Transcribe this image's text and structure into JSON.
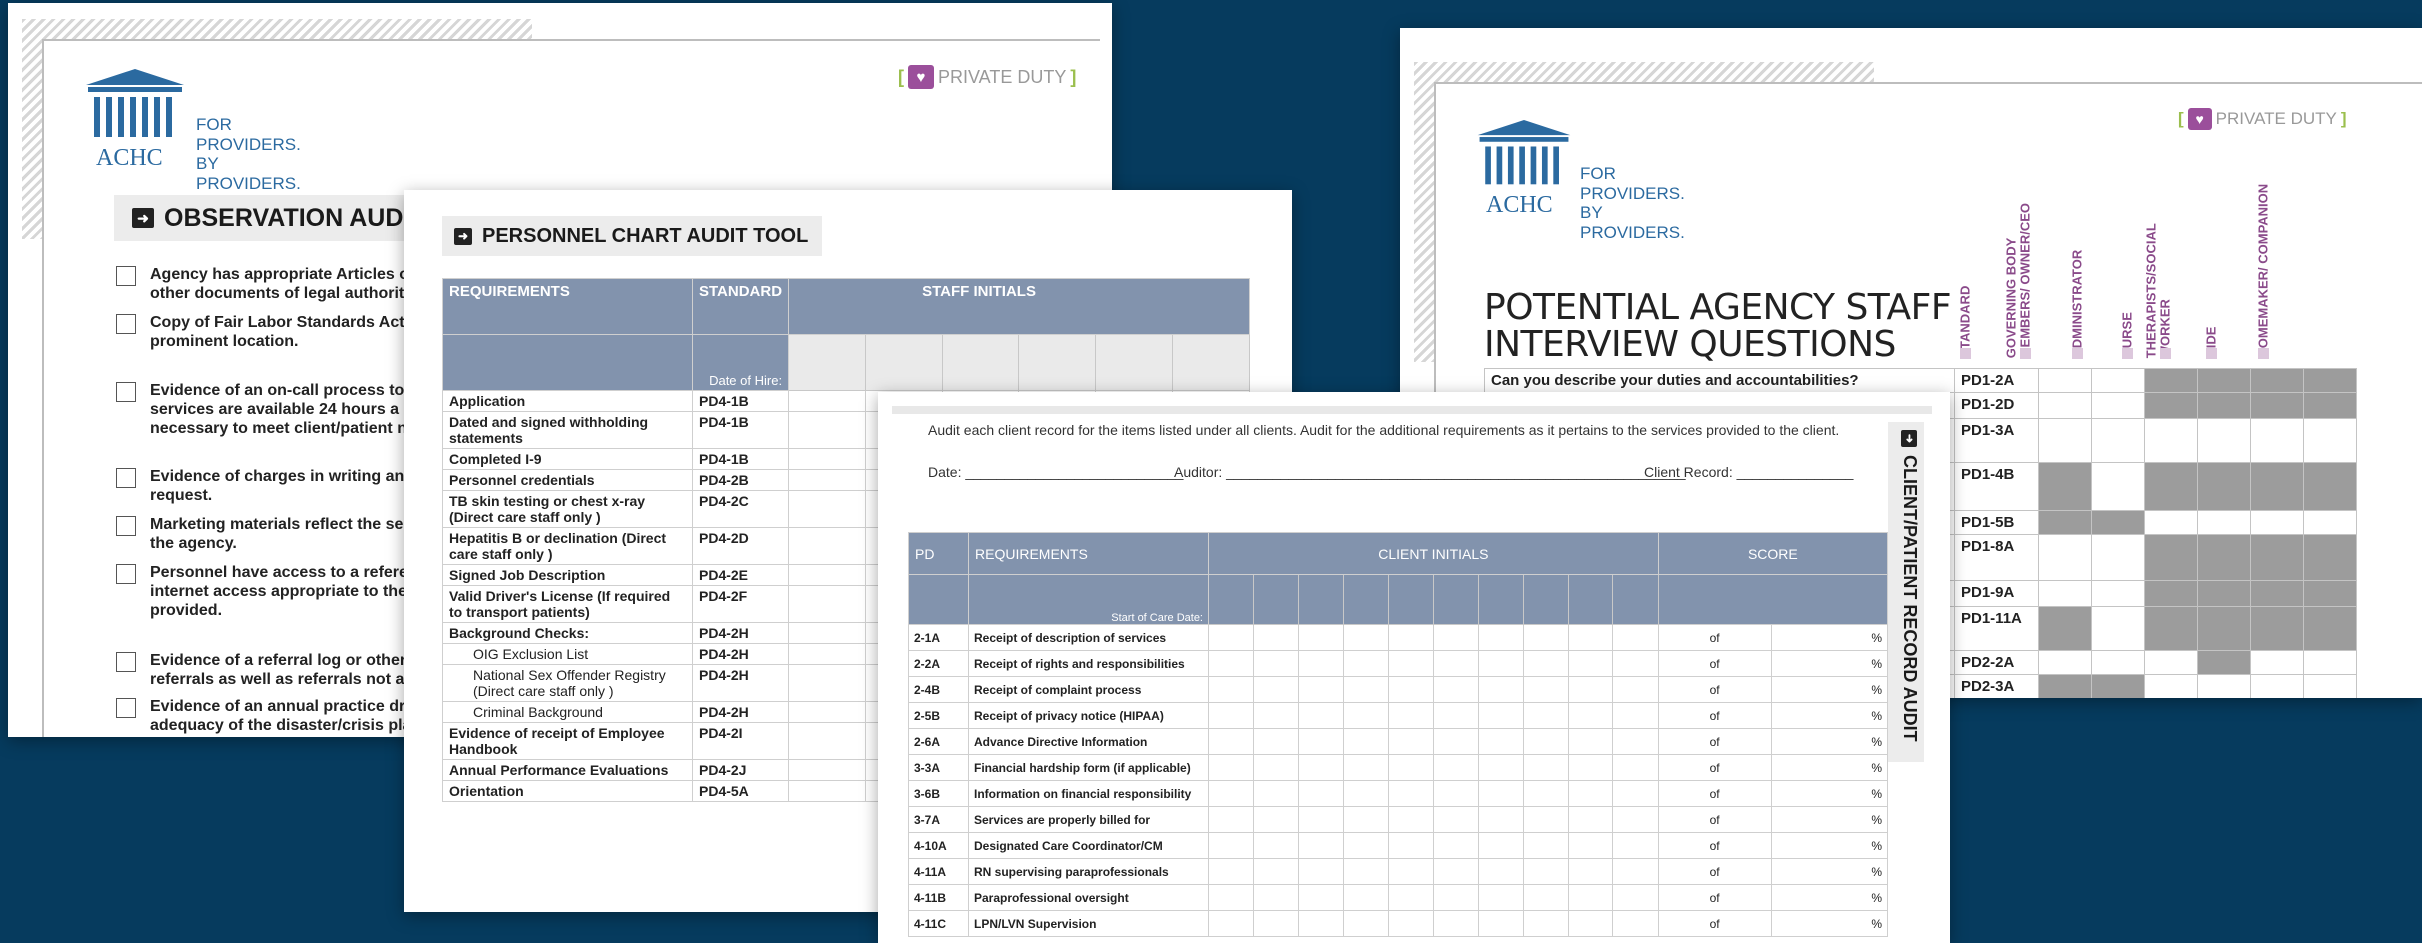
{
  "brand": {
    "logo_word": "ACHC",
    "registered": "®",
    "tagline_1": "FOR PROVIDERS.",
    "tagline_2": "BY PROVIDERS.",
    "private_duty": "PRIVATE DUTY",
    "colors": {
      "brand_blue": "#2b6aa0",
      "heart_purple": "#9b4f9b",
      "bracket_green": "#9bbf4e",
      "table_header": "#8293ad",
      "background": "#063b5e"
    }
  },
  "observation": {
    "title": "OBSERVATION AUDIT TO",
    "items": [
      [
        "Agency has appropriate Articles of",
        "other documents of legal authority"
      ],
      [
        "Copy of Fair Labor Standards Act is",
        "prominent location."
      ],
      [
        "Evidence of an on-call process to e",
        "services are available 24 hours a da",
        "necessary to meet client/patient n"
      ],
      [
        "Evidence of charges in writing and",
        "request."
      ],
      [
        "Marketing materials reflect the ser",
        "the agency."
      ],
      [
        "Personnel have access to a referen",
        "internet access appropriate to the",
        "provided."
      ],
      [
        "Evidence of a referral log or other t",
        "referrals as well as referrals not ad"
      ],
      [
        "Evidence of an annual practice drill",
        "adequacy of the disaster/crisis pla"
      ]
    ]
  },
  "personnel": {
    "title": "PERSONNEL CHART AUDIT TOOL",
    "headers": {
      "requirements": "REQUIREMENTS",
      "standard": "STANDARD",
      "staff_initials": "STAFF INITIALS",
      "date_of_hire": "Date of Hire:"
    },
    "rows": [
      {
        "req": "Application",
        "std": "PD4-1B"
      },
      {
        "req": "Dated and signed withholding statements",
        "std": "PD4-1B"
      },
      {
        "req": "Completed I-9",
        "std": "PD4-1B"
      },
      {
        "req": "Personnel credentials",
        "std": "PD4-2B"
      },
      {
        "req": "TB skin testing or chest x-ray (Direct care staff  only )",
        "std": "PD4-2C"
      },
      {
        "req": "Hepatitis B or declination (Direct care staff  only )",
        "std": "PD4-2D"
      },
      {
        "req": "Signed Job Description",
        "std": "PD4-2E"
      },
      {
        "req": "Valid Driver's License (If required to transport patients)",
        "std": "PD4-2F"
      },
      {
        "req": "Background Checks:",
        "std": "PD4-2H"
      },
      {
        "req": "OIG Exclusion List",
        "std": "PD4-2H",
        "indent": true
      },
      {
        "req": "National Sex Offender Registry (Direct care staff only )",
        "std": "PD4-2H",
        "indent": true
      },
      {
        "req": "Criminal Background",
        "std": "PD4-2H",
        "indent": true
      },
      {
        "req": "Evidence of receipt of Employee Handbook",
        "std": "PD4-2I"
      },
      {
        "req": "Annual Performance Evaluations",
        "std": "PD4-2J"
      },
      {
        "req": "Orientation",
        "std": "PD4-5A"
      }
    ]
  },
  "client": {
    "intro": "Audit each client record for the items listed under all clients. Audit for the additional requirements as it pertains to the services provided to the client.",
    "date_label": "Date: ____________________________",
    "auditor_label": "Auditor: ___________________________________________________________",
    "client_record_label": "Client Record: _______________",
    "vertical_title": "CLIENT/PATIENT RECORD AUDIT",
    "headers": {
      "pd": "PD",
      "requirements": "REQUIREMENTS",
      "client_initials": "CLIENT INITIALS",
      "score": "SCORE",
      "start_of_care": "Start of Care Date:"
    },
    "of": "of",
    "pct": "%",
    "rows": [
      {
        "pd": "2-1A",
        "req": "Receipt of description of services"
      },
      {
        "pd": "2-2A",
        "req": "Receipt of rights and responsibilities"
      },
      {
        "pd": "2-4B",
        "req": "Receipt of complaint process"
      },
      {
        "pd": "2-5B",
        "req": "Receipt of privacy notice (HIPAA)"
      },
      {
        "pd": "2-6A",
        "req": "Advance Directive Information"
      },
      {
        "pd": "3-3A",
        "req": "Financial hardship form (if applicable)"
      },
      {
        "pd": "3-6B",
        "req": "Information on financial responsibility"
      },
      {
        "pd": "3-7A",
        "req": "Services are properly billed for"
      },
      {
        "pd": "4-10A",
        "req": "Designated Care Coordinator/CM"
      },
      {
        "pd": "4-11A",
        "req": "RN supervising paraprofessionals"
      },
      {
        "pd": "4-11B",
        "req": "Paraprofessional oversight"
      },
      {
        "pd": "4-11C",
        "req": "LPN/LVN Supervision"
      }
    ]
  },
  "interview": {
    "title_line1": "POTENTIAL AGENCY STAFF",
    "title_line2": "INTERVIEW QUESTIONS",
    "roles": [
      "STANDARD",
      "GOVERNING BODY MEMBERS/ OWNER/CEO",
      "ADMINISTRATOR",
      "NURSE",
      "THERAPISTS/SOCIAL WORKER",
      "AIDE",
      "HOMEMAKER/ COMPANION"
    ],
    "rows": [
      {
        "q": "Can you describe your duties and accountabilities?",
        "std": "PD1-2A",
        "marks": [
          0,
          0,
          1,
          1,
          1,
          1
        ]
      },
      {
        "q": "",
        "std": "PD1-2D",
        "marks": [
          0,
          0,
          1,
          1,
          1,
          1
        ]
      },
      {
        "q": "",
        "std": "PD1-3A",
        "marks": [
          0,
          0,
          0,
          0,
          0,
          0
        ]
      },
      {
        "q": "",
        "std": "PD1-4B",
        "marks": [
          1,
          0,
          1,
          1,
          1,
          1
        ]
      },
      {
        "q": "",
        "std": "PD1-5B",
        "marks": [
          1,
          1,
          0,
          0,
          0,
          0
        ]
      },
      {
        "q": "",
        "std": "PD1-8A",
        "marks": [
          0,
          0,
          1,
          1,
          1,
          1
        ]
      },
      {
        "q": "",
        "std": "PD1-9A",
        "marks": [
          0,
          0,
          1,
          1,
          1,
          1
        ]
      },
      {
        "q": "",
        "std": "PD1-11A",
        "marks": [
          1,
          0,
          1,
          1,
          1,
          1
        ]
      },
      {
        "q": "",
        "std": "PD2-2A",
        "marks": [
          0,
          0,
          0,
          1,
          0,
          0
        ]
      },
      {
        "q": "",
        "std": "PD2-3A",
        "marks": [
          1,
          1,
          0,
          0,
          0,
          0
        ]
      }
    ]
  }
}
